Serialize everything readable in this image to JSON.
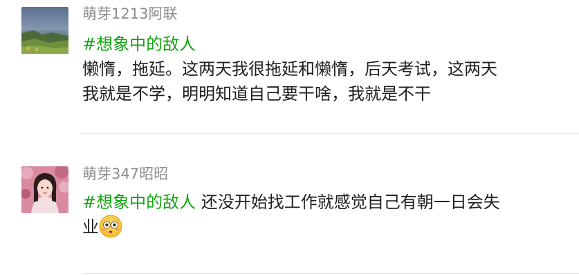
{
  "posts": [
    {
      "username": "萌芽1213阿联",
      "avatar_icon": "landscape-photo-avatar",
      "hashtag": "#想象中的敌人",
      "text_line_1": "懒惰，拖延。这两天我很拖延和懒惰，后天考试，这两天",
      "text_line_2": "我就是不学，明明知道自己要干啥，我就是不干"
    },
    {
      "username": "萌芽347昭昭",
      "avatar_icon": "portrait-photo-avatar",
      "hashtag": "#想象中的敌人",
      "text_after_hashtag": " 还没开始找工作就感觉自己有朝一日会失",
      "text_line_2": "业",
      "emoji_icon": "flushed-face-emoji"
    }
  ],
  "colors": {
    "hashtag": "#16a314",
    "username": "#8c8c8c",
    "text": "#1f1f1f",
    "divider": "#e6e6e6"
  }
}
